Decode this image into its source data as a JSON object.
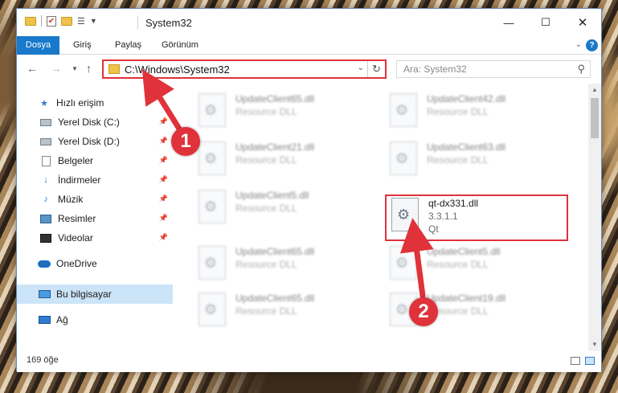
{
  "window": {
    "title": "System32",
    "min_glyph": "—",
    "max_glyph": "☐",
    "close_glyph": "✕"
  },
  "ribbon": {
    "file_tab": "Dosya",
    "tabs": [
      "Giriş",
      "Paylaş",
      "Görünüm"
    ],
    "help": "?"
  },
  "address": {
    "path": "C:\\Windows\\System32",
    "search_placeholder": "Ara: System32"
  },
  "nav": {
    "items": [
      {
        "label": "Hızlı erişim",
        "icon": "star-icon",
        "pinned": false
      },
      {
        "label": "Yerel Disk (C:)",
        "icon": "drive-icon",
        "pinned": true
      },
      {
        "label": "Yerel Disk (D:)",
        "icon": "drive-icon",
        "pinned": true
      },
      {
        "label": "Belgeler",
        "icon": "documents-icon",
        "pinned": true
      },
      {
        "label": "İndirmeler",
        "icon": "download-icon",
        "pinned": true
      },
      {
        "label": "Müzik",
        "icon": "music-icon",
        "pinned": true
      },
      {
        "label": "Resimler",
        "icon": "pictures-icon",
        "pinned": true
      },
      {
        "label": "Videolar",
        "icon": "videos-icon",
        "pinned": true
      },
      {
        "label": "OneDrive",
        "icon": "onedrive-icon",
        "pinned": false
      },
      {
        "label": "Bu bilgisayar",
        "icon": "this-pc-icon",
        "pinned": false,
        "selected": true
      },
      {
        "label": "Ağ",
        "icon": "network-icon",
        "pinned": false
      }
    ]
  },
  "files": [
    {
      "name": "UpdateClient65.dll",
      "line2": "Resource DLL",
      "line3": ""
    },
    {
      "name": "UpdateClient42.dll",
      "line2": "Resource DLL",
      "line3": ""
    },
    {
      "name": "UpdateClient21.dll",
      "line2": "Resource DLL",
      "line3": ""
    },
    {
      "name": "UpdateClient63.dll",
      "line2": "Resource DLL",
      "line3": ""
    },
    {
      "name": "UpdateClient5.dll",
      "line2": "Resource DLL",
      "line3": ""
    },
    {
      "name": "qt-dx331.dll",
      "line2": "3.3.1.1",
      "line3": "Qt"
    },
    {
      "name": "UpdateClient65.dll",
      "line2": "Resource DLL",
      "line3": ""
    },
    {
      "name": "UpdateClient5.dll",
      "line2": "Resource DLL",
      "line3": ""
    },
    {
      "name": "UpdateClient65.dll",
      "line2": "Resource DLL",
      "line3": ""
    },
    {
      "name": "UpdateClient19.dll",
      "line2": "Resource DLL",
      "line3": ""
    }
  ],
  "status": {
    "count": "169 öğe"
  },
  "annotations": {
    "step1": "1",
    "step2": "2",
    "color": "#e0323a"
  }
}
